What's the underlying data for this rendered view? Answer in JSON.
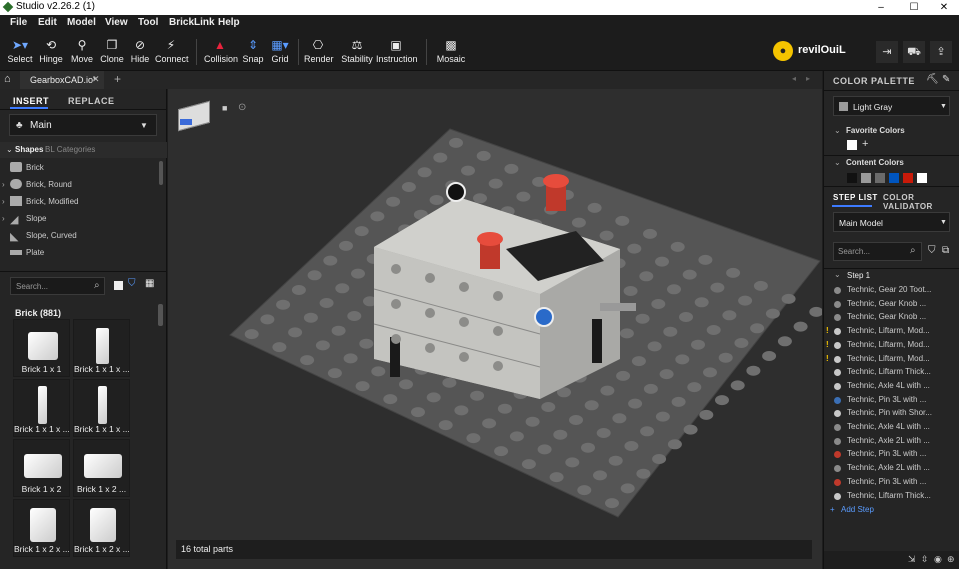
{
  "window": {
    "title": "Studio v2.26.2 (1)",
    "min": "–",
    "max": "☐",
    "close": "✕"
  },
  "menu": [
    "File",
    "Edit",
    "Model",
    "View",
    "Tool",
    "BrickLink",
    "Help"
  ],
  "toolbar": {
    "select": "Select",
    "hinge": "Hinge",
    "move": "Move",
    "clone": "Clone",
    "hide": "Hide",
    "connect": "Connect",
    "collision": "Collision",
    "snap": "Snap",
    "grid": "Grid",
    "render": "Render",
    "stability": "Stability",
    "instruction": "Instruction",
    "mosaic": "Mosaic",
    "username": "revilOuiL"
  },
  "tabs": {
    "file": "GearboxCAD.io*",
    "close": "✕",
    "add": "+"
  },
  "left": {
    "insert": "INSERT",
    "replace": "REPLACE",
    "model": "Main",
    "shapes": "Shapes",
    "bl_categories": "BL Categories",
    "categories": [
      "Brick",
      "Brick, Round",
      "Brick, Modified",
      "Slope",
      "Slope, Curved",
      "Plate"
    ],
    "search_placeholder": "Search...",
    "group": "Brick (881)",
    "bricks": [
      "Brick 1 x 1",
      "Brick 1 x 1 x ...",
      "Brick 1 x 1 x ...",
      "Brick 1 x 1 x ...",
      "Brick 1 x 2",
      "Brick 1 x 2 ...",
      "Brick 1 x 2 x ...",
      "Brick 1 x 2 x ..."
    ]
  },
  "viewport": {
    "status": "16 total parts"
  },
  "right": {
    "palette_title": "COLOR PALETTE",
    "color": "Light Gray",
    "favorite_colors": "Favorite Colors",
    "add": "+",
    "content_colors": "Content Colors",
    "content_swatches": [
      "#111111",
      "#9a9a9a",
      "#6b6b6b",
      "#0055bf",
      "#c91a09",
      "#ffffff"
    ],
    "tab_steps": "STEP LIST",
    "tab_validator": "COLOR VALIDATOR",
    "model": "Main Model",
    "search_placeholder": "Search...",
    "step": "Step 1",
    "steps": [
      {
        "label": "Technic, Gear 20 Toot...",
        "color": "#8a8a8a",
        "warn": false
      },
      {
        "label": "Technic, Gear Knob ...",
        "color": "#8a8a8a",
        "warn": false
      },
      {
        "label": "Technic, Gear Knob ...",
        "color": "#8a8a8a",
        "warn": false
      },
      {
        "label": "Technic, Liftarm, Mod...",
        "color": "#c8c8c8",
        "warn": true
      },
      {
        "label": "Technic, Liftarm, Mod...",
        "color": "#c8c8c8",
        "warn": true
      },
      {
        "label": "Technic, Liftarm, Mod...",
        "color": "#c8c8c8",
        "warn": true
      },
      {
        "label": "Technic, Liftarm Thick...",
        "color": "#c8c8c8",
        "warn": false
      },
      {
        "label": "Technic, Axle  4L with ...",
        "color": "#c8c8c8",
        "warn": false
      },
      {
        "label": "Technic, Pin 3L with ...",
        "color": "#3b6fb5",
        "warn": false
      },
      {
        "label": "Technic, Pin with Shor...",
        "color": "#c8c8c8",
        "warn": false
      },
      {
        "label": "Technic, Axle  4L with ...",
        "color": "#8a8a8a",
        "warn": false
      },
      {
        "label": "Technic, Axle  2L with ...",
        "color": "#8a8a8a",
        "warn": false
      },
      {
        "label": "Technic, Pin 3L with ...",
        "color": "#c0392b",
        "warn": false
      },
      {
        "label": "Technic, Axle  2L with ...",
        "color": "#8a8a8a",
        "warn": false
      },
      {
        "label": "Technic, Pin 3L with ...",
        "color": "#c0392b",
        "warn": false
      },
      {
        "label": "Technic, Liftarm Thick...",
        "color": "#c8c8c8",
        "warn": false
      }
    ],
    "add_step": "Add Step"
  }
}
